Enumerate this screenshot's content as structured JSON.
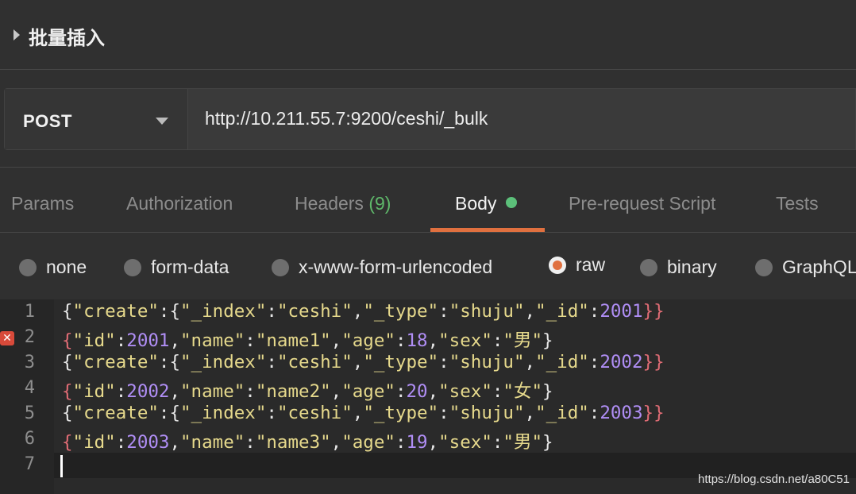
{
  "header": {
    "title": "批量插入"
  },
  "request": {
    "method": "POST",
    "url": "http://10.211.55.7:9200/ceshi/_bulk"
  },
  "tabs": [
    {
      "label": "Params"
    },
    {
      "label": "Authorization"
    },
    {
      "label": "Headers",
      "count": "(9)"
    },
    {
      "label": "Body",
      "active": true,
      "indicator": "green-dot"
    },
    {
      "label": "Pre-request Script"
    },
    {
      "label": "Tests"
    }
  ],
  "body_types": [
    {
      "label": "none",
      "selected": false
    },
    {
      "label": "form-data",
      "selected": false
    },
    {
      "label": "x-www-form-urlencoded",
      "selected": false
    },
    {
      "label": "raw",
      "selected": true
    },
    {
      "label": "binary",
      "selected": false
    },
    {
      "label": "GraphQL",
      "selected": false
    }
  ],
  "editor": {
    "line_numbers": [
      "1",
      "2",
      "3",
      "4",
      "5",
      "6",
      "7"
    ],
    "error_line": "2",
    "lines": [
      "{\"create\":{\"_index\":\"ceshi\",\"_type\":\"shuju\",\"_id\":2001}}",
      "{\"id\":2001,\"name\":\"name1\",\"age\":18,\"sex\":\"男\"}",
      "{\"create\":{\"_index\":\"ceshi\",\"_type\":\"shuju\",\"_id\":2002}}",
      "{\"id\":2002,\"name\":\"name2\",\"age\":20,\"sex\":\"女\"}",
      "{\"create\":{\"_index\":\"ceshi\",\"_type\":\"shuju\",\"_id\":2003}}",
      "{\"id\":2003,\"name\":\"name3\",\"age\":19,\"sex\":\"男\"}",
      ""
    ]
  },
  "watermark": "https://blog.csdn.net/a80C51",
  "colors": {
    "accent": "#e0703f",
    "active_dot": "#5cc07a",
    "headers_count": "#5fb86a",
    "string": "#e6d98c",
    "number": "#b08ef5",
    "bracket_mismatch": "#e06c75",
    "error": "#d84a3a"
  }
}
